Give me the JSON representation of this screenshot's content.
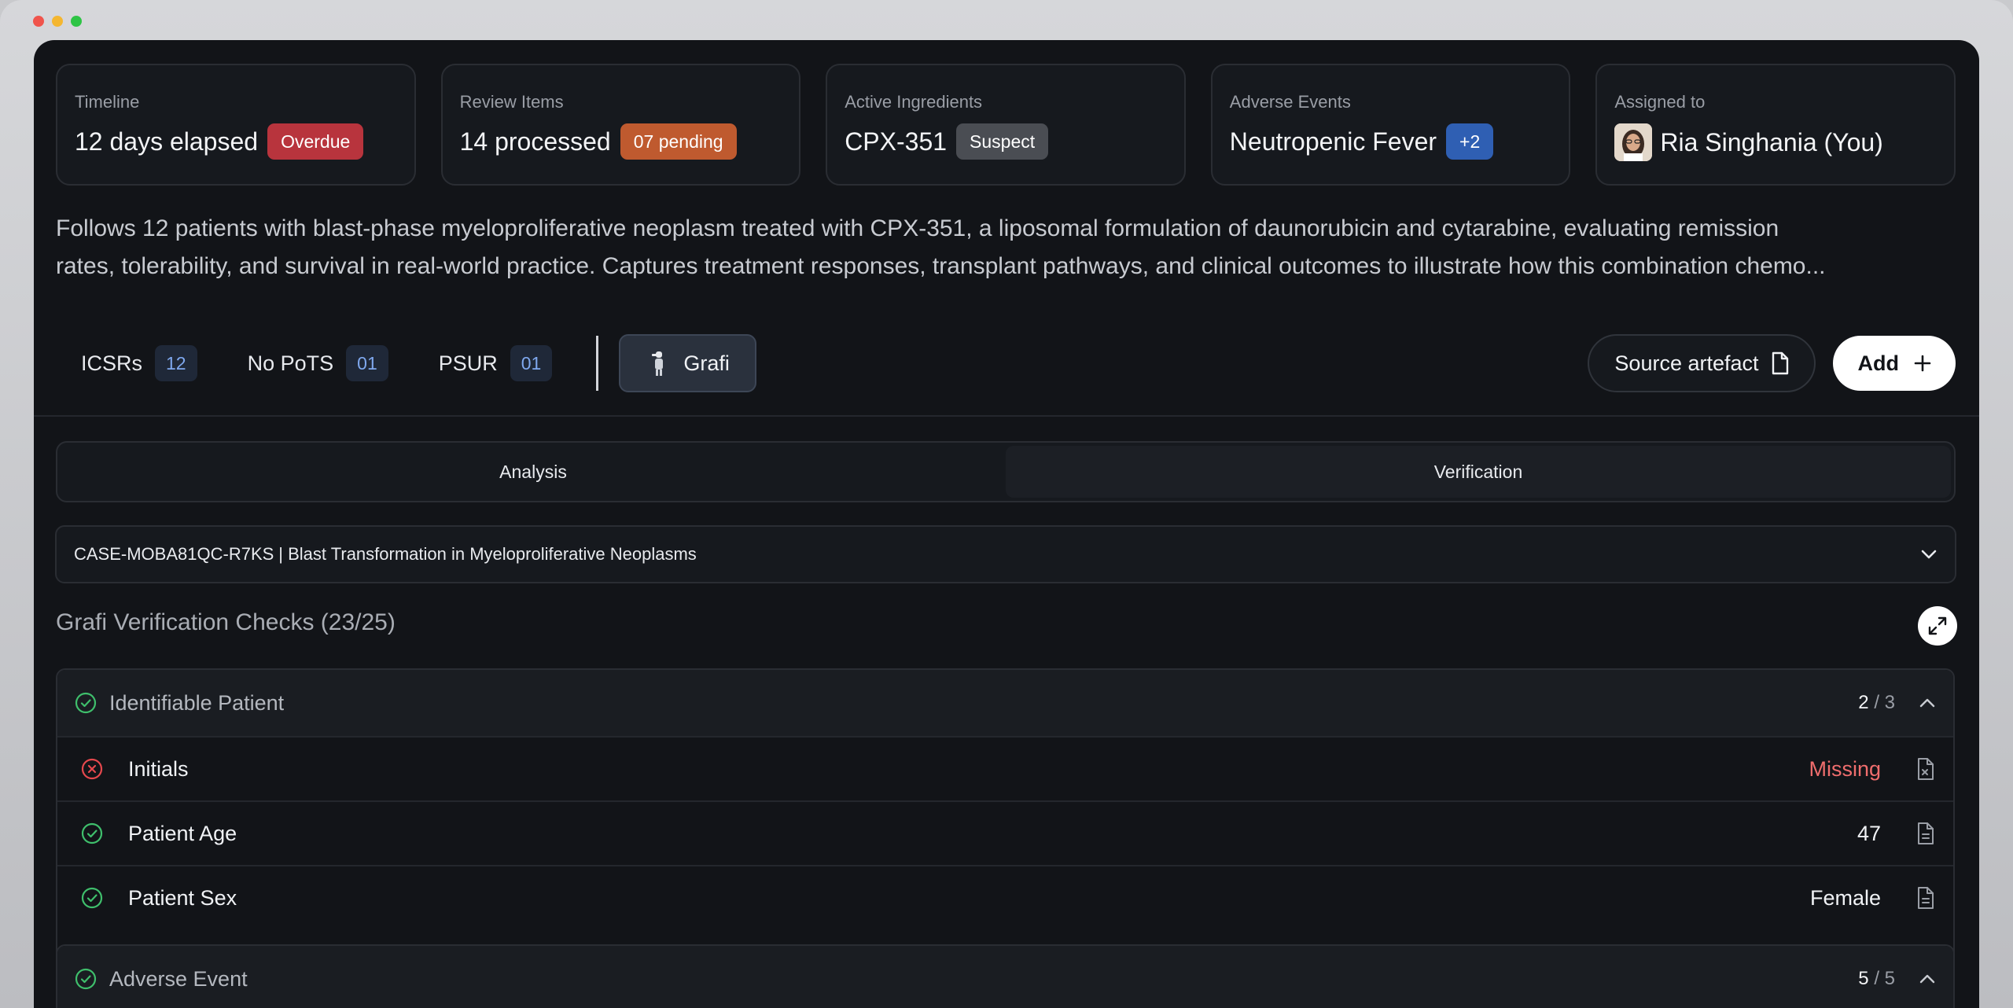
{
  "cards": [
    {
      "label": "Timeline",
      "value": "12 days elapsed",
      "badge": "Overdue"
    },
    {
      "label": "Review Items",
      "value": "14 processed",
      "badge": "07 pending"
    },
    {
      "label": "Active Ingredients",
      "value": "CPX-351",
      "badge": "Suspect"
    },
    {
      "label": "Adverse Events",
      "value": "Neutropenic Fever",
      "badge": "+2"
    },
    {
      "label": "Assigned to",
      "value": "Ria Singhania (You)"
    }
  ],
  "description": {
    "line1": "Follows 12 patients with blast-phase myeloproliferative neoplasm treated with CPX-351, a liposomal formulation of daunorubicin and cytarabine, evaluating remission",
    "line2": "rates, tolerability, and survival in real-world practice. Captures treatment responses, transplant pathways, and clinical outcomes to illustrate how this combination chemo..."
  },
  "toolbar": {
    "items": [
      {
        "label": "ICSRs",
        "count": "12"
      },
      {
        "label": "No PoTS",
        "count": "01"
      },
      {
        "label": "PSUR",
        "count": "01"
      }
    ],
    "grafi_label": "Grafi",
    "source_label": "Source artefact",
    "add_label": "Add"
  },
  "tabs": [
    {
      "label": "Analysis",
      "active": false
    },
    {
      "label": "Verification",
      "active": true
    }
  ],
  "case_select": {
    "case_id": "CASE-MOBA81QC-R7KS",
    "title": "| Blast Transformation in Myeloproliferative Neoplasms"
  },
  "section_title": "Grafi Verification Checks (23/25)",
  "groups": [
    {
      "name": "Identifiable Patient",
      "done": "2",
      "total": "/ 3",
      "rows": [
        {
          "label": "Initials",
          "value": "Missing",
          "status": "fail"
        },
        {
          "label": "Patient Age",
          "value": "47",
          "status": "pass"
        },
        {
          "label": "Patient Sex",
          "value": "Female",
          "status": "pass"
        }
      ]
    },
    {
      "name": "Adverse Event",
      "done": "5",
      "total": "/ 5"
    }
  ],
  "colors": {
    "pass": "#3fbf6c",
    "fail": "#e5484d",
    "overdue": "#b8343d",
    "pending": "#bf5a2f"
  }
}
